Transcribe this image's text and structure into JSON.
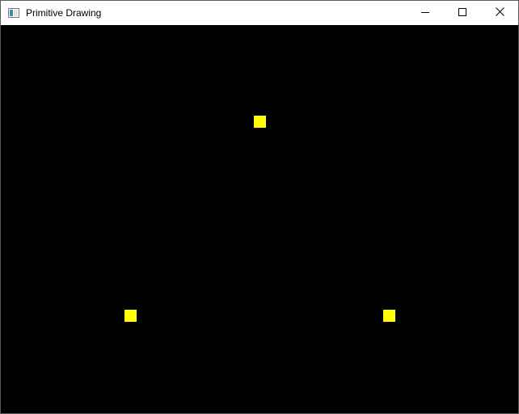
{
  "window": {
    "title": "Primitive Drawing"
  },
  "icons": {
    "app": "window-app-icon",
    "minimize": "minimize-icon",
    "maximize": "maximize-icon",
    "close": "close-icon"
  },
  "canvas": {
    "background_color": "#000000",
    "point_color": "#ffff00",
    "primitive": "points"
  }
}
